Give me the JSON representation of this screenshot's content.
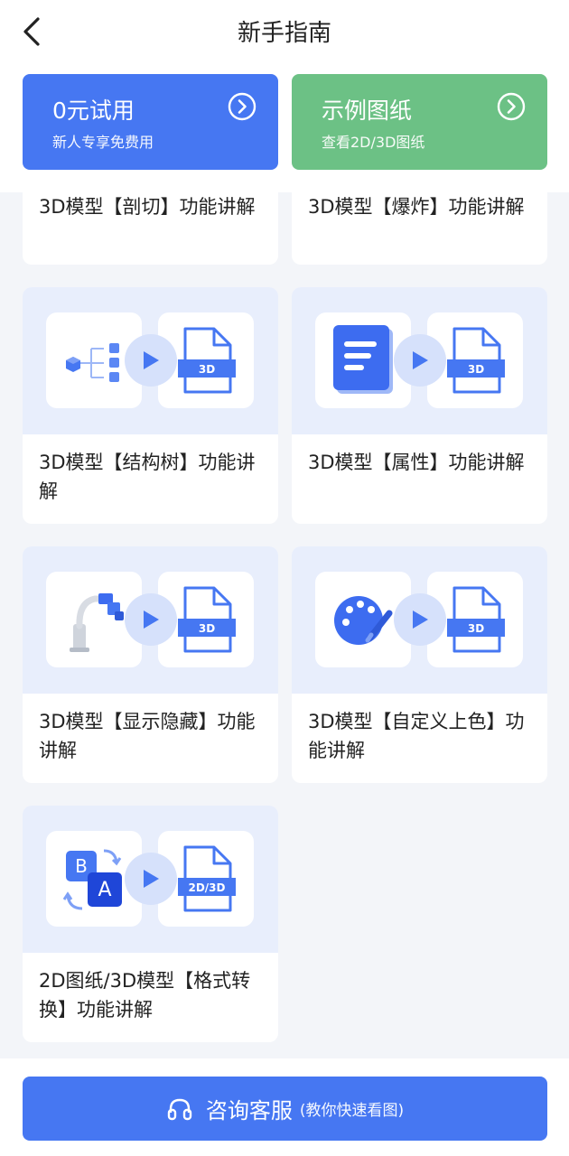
{
  "header": {
    "title": "新手指南"
  },
  "promo": {
    "trial": {
      "title": "0元试用",
      "subtitle": "新人专享免费用"
    },
    "sample": {
      "title": "示例图纸",
      "subtitle": "查看2D/3D图纸"
    }
  },
  "tutorials": [
    {
      "label": "3D模型【剖切】功能讲解"
    },
    {
      "label": "3D模型【爆炸】功能讲解"
    },
    {
      "label": "3D模型【结构树】功能讲解",
      "badge": "3D"
    },
    {
      "label": "3D模型【属性】功能讲解",
      "badge": "3D"
    },
    {
      "label": "3D模型【显示隐藏】功能讲解",
      "badge": "3D"
    },
    {
      "label": "3D模型【自定义上色】功能讲解",
      "badge": "3D"
    },
    {
      "label": "2D图纸/3D模型【格式转换】功能讲解",
      "badge": "2D/3D",
      "glyph_b": "B",
      "glyph_a": "A"
    }
  ],
  "footer": {
    "button_label": "咨询客服",
    "button_hint": "(教你快速看图)"
  },
  "colors": {
    "primary": "#4677f2",
    "green": "#6cc185",
    "thumb_bg": "#e8eefc"
  },
  "icons": {
    "back": "chevron-left-icon",
    "go": "circle-arrow-right-icon",
    "play": "play-icon",
    "file": "file-3d-icon",
    "headset": "headset-icon"
  }
}
